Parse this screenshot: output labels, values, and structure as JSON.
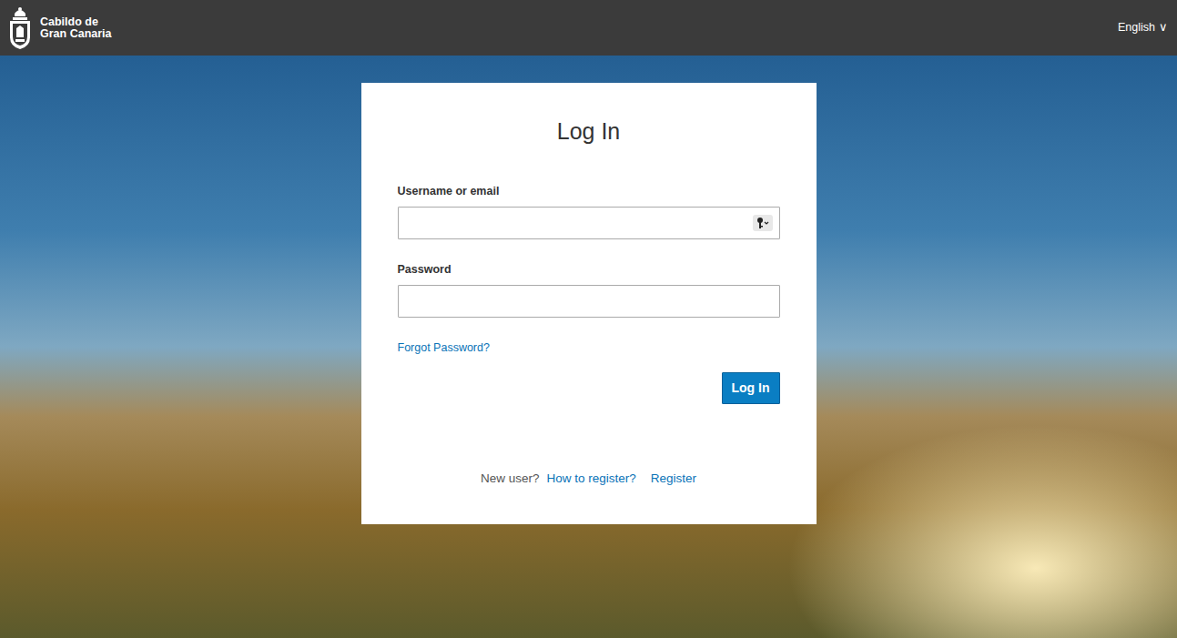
{
  "header": {
    "logo_line1": "Cabildo de",
    "logo_line2": "Gran Canaria",
    "language": "English",
    "language_caret": "∨"
  },
  "form": {
    "title": "Log In",
    "username_label": "Username or email",
    "password_label": "Password",
    "forgot_link": "Forgot Password?",
    "submit": "Log In"
  },
  "footer": {
    "prompt": "New user?",
    "links": [
      "How to register?",
      "Register"
    ]
  }
}
